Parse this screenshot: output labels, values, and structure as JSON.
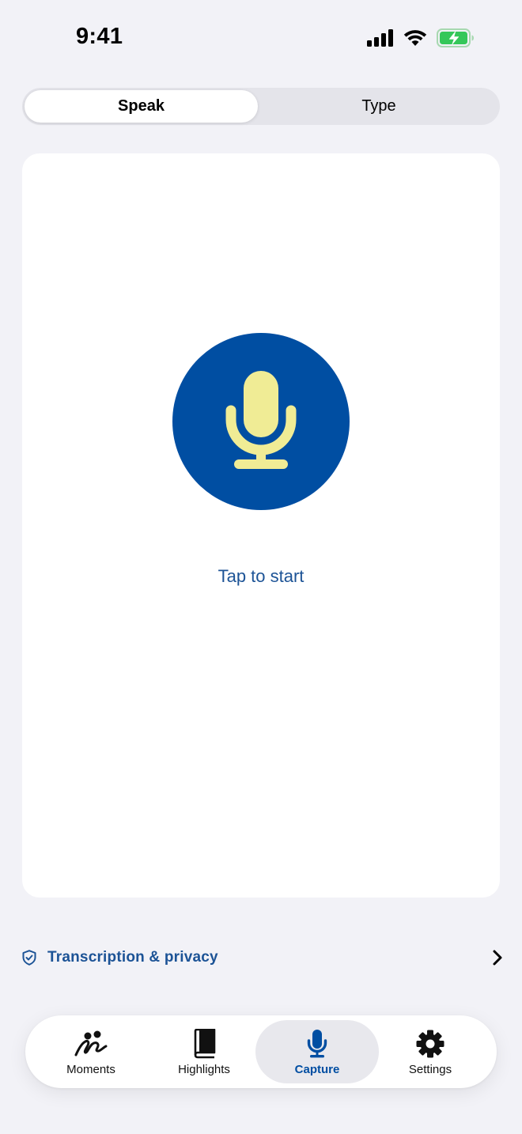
{
  "status_bar": {
    "time": "9:41",
    "icons": [
      "cellular-signal-icon",
      "wifi-icon",
      "battery-charging-icon"
    ]
  },
  "mode_switch": {
    "options": [
      "Speak",
      "Type"
    ],
    "selected": "Speak"
  },
  "capture_card": {
    "mic_icon": "microphone-icon",
    "prompt": "Tap to start"
  },
  "privacy_link": {
    "icon": "shield-check-icon",
    "label": "Transcription & privacy",
    "trailing_icon": "chevron-right-icon"
  },
  "tab_bar": {
    "items": [
      {
        "label": "Moments",
        "icon": "moments-icon"
      },
      {
        "label": "Highlights",
        "icon": "book-icon"
      },
      {
        "label": "Capture",
        "icon": "microphone-icon"
      },
      {
        "label": "Settings",
        "icon": "gear-icon"
      }
    ],
    "selected": "Capture"
  },
  "colors": {
    "background": "#f2f2f7",
    "brand_blue": "#004ea2",
    "mic_yellow": "#f0ec95",
    "link_blue": "#1c5396",
    "battery_green": "#34c759"
  }
}
